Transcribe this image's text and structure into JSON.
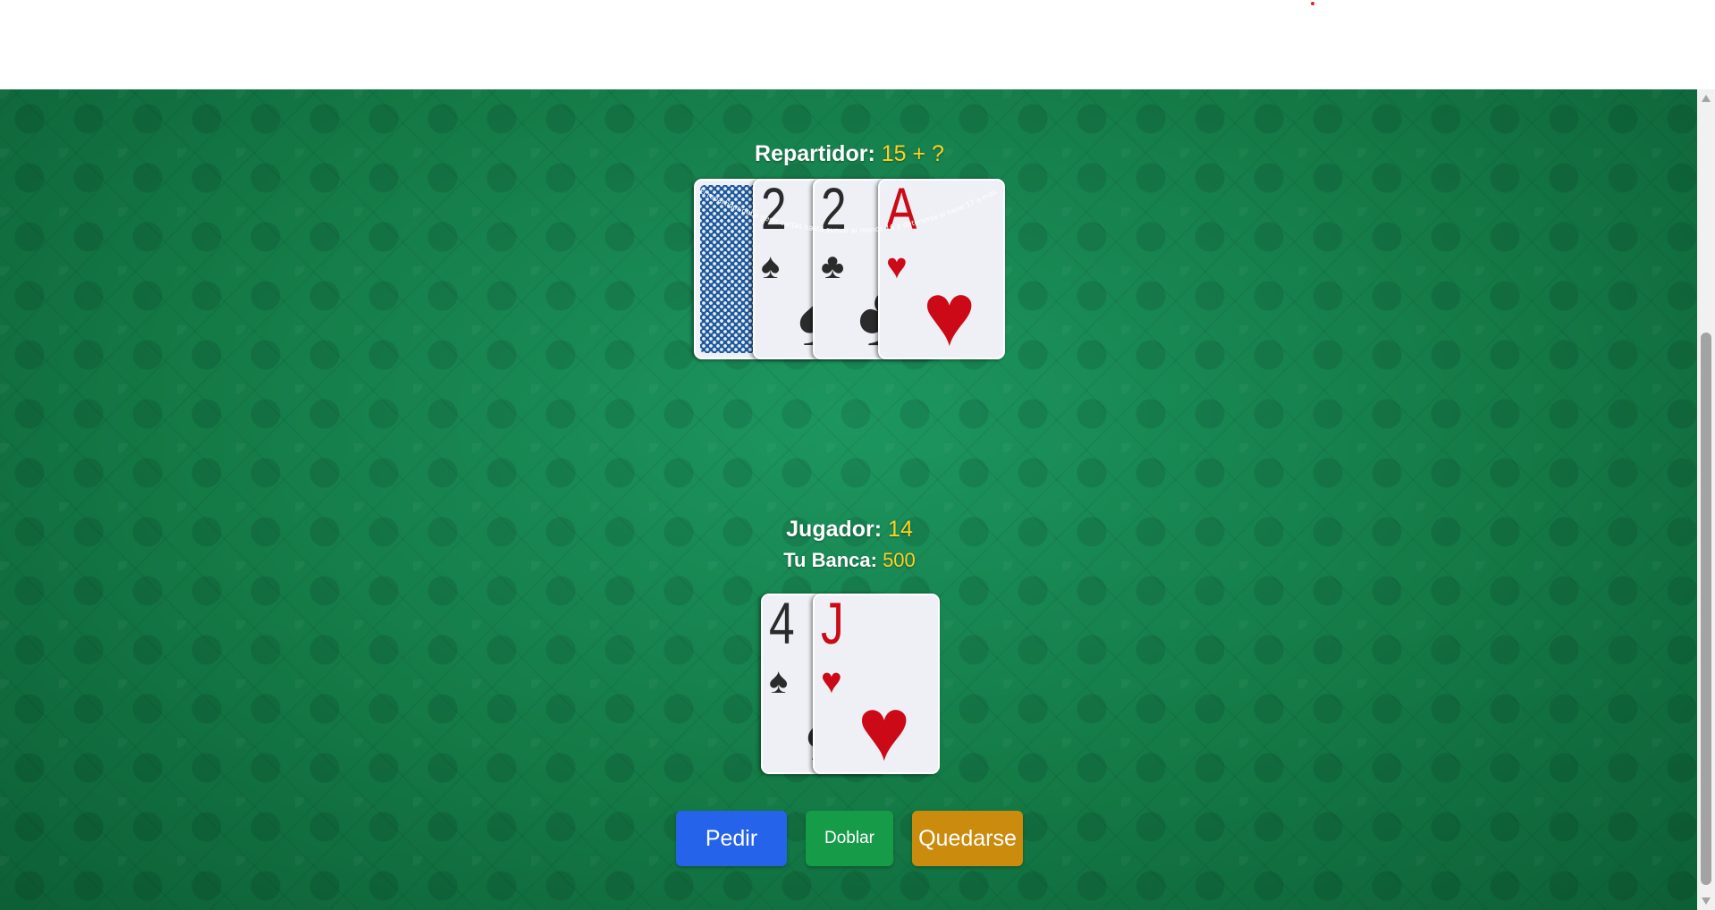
{
  "dealer": {
    "label": "Repartidor:",
    "score": "15 + ?",
    "cards": [
      {
        "rank": "",
        "suit": "",
        "face_down": true
      },
      {
        "rank": "2",
        "suit": "♠",
        "color": "black"
      },
      {
        "rank": "2",
        "suit": "♣",
        "color": "black"
      },
      {
        "rank": "A",
        "suit": "♥",
        "color": "red"
      }
    ]
  },
  "rules_text": "El repartidor debe pedir cartas hasta sumar al menos 16 y detenerse si tiene 17 o más.",
  "player": {
    "label": "Jugador:",
    "score": "14",
    "bank_label": "Tu Banca:",
    "bank_value": "500",
    "cards": [
      {
        "rank": "4",
        "suit": "♠",
        "color": "black"
      },
      {
        "rank": "J",
        "suit": "♥",
        "color": "red"
      }
    ]
  },
  "buttons": {
    "hit": "Pedir",
    "double": "Doblar",
    "stand": "Quedarse"
  },
  "colors": {
    "felt": "#16804a",
    "value_highlight": "#ffd21f",
    "hit_button": "#2563eb",
    "double_button": "#169b48",
    "stand_button": "#cb8b0c",
    "card_red": "#cc0a17",
    "card_back": "#1e5a9c"
  }
}
